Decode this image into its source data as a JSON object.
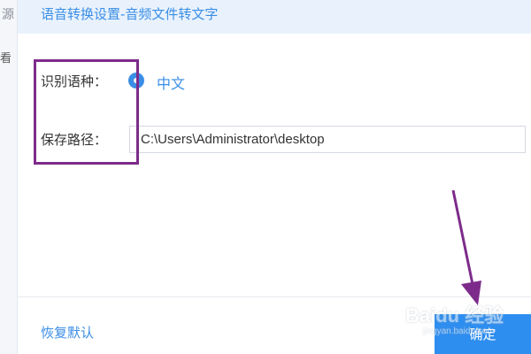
{
  "background_app": {
    "text_1": "源",
    "text_2": "看"
  },
  "dialog": {
    "title": "语音转换设置-音频文件转文字",
    "language": {
      "label": "识别语种：",
      "selected_option": "中文"
    },
    "save_path": {
      "label": "保存路径：",
      "value": "C:\\Users\\Administrator\\desktop"
    },
    "footer": {
      "reset_label": "恢复默认",
      "confirm_label": "确定"
    }
  },
  "watermark": {
    "brand": "Baidu 经验",
    "url": "jingyan.baidu.com"
  },
  "colors": {
    "accent": "#3a8ee6",
    "header_bg": "#e9f2fc",
    "annotation": "#7d2b8b",
    "button_bg": "#2e8ef0"
  }
}
